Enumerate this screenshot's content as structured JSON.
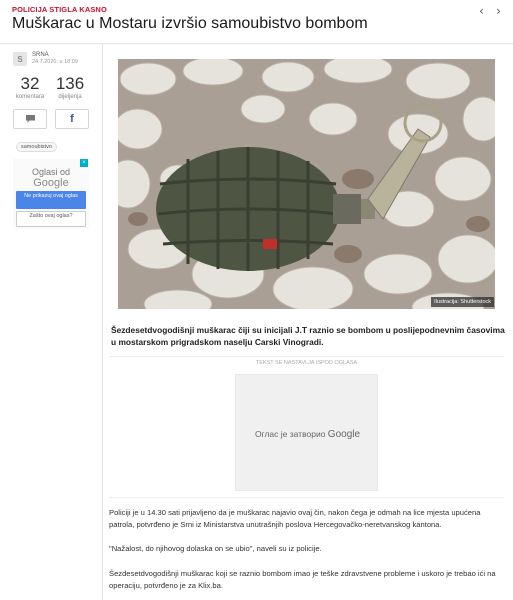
{
  "header": {
    "kicker": "POLICIJA STIGLA KASNO",
    "title": "Muškarac u Mostaru izvršio samoubistvo bombom",
    "prev_icon": "chevron-left-icon",
    "next_icon": "chevron-right-icon"
  },
  "sidebar": {
    "source_logo": "S",
    "source_name": "SRNA",
    "date": "24.7.2020. u 18:09",
    "comments_count": "32",
    "comments_label": "komentara",
    "shares_count": "136",
    "shares_label": "dijeljenja",
    "comment_icon": "comment-icon",
    "facebook_icon": "facebook-icon",
    "tag": "samoubistvo",
    "ad": {
      "line1": "Oglasi od",
      "line2": "Google",
      "stop_button": "Ne prikazuj ovaj oglas",
      "why_button": "Zašto ovaj oglas?"
    }
  },
  "article": {
    "image_credit": "Ilustracija: Shutterstock",
    "lead": "Šezdesetdvogodišnji muškarac čiji su inicijali J.T raznio se bombom u poslijepodnevnim časovima u mostarskom prigradskom naselju Carski Vinogradi.",
    "ad_notice": "TEKST SE NASTAVLJA ISPOD OGLASA",
    "closed_ad_text": "Oглас је затворио",
    "closed_ad_brand": "Google",
    "paragraphs": [
      "Policiji je u 14.30 sati prijavljeno da je muškarac najavio ovaj čin, nakon čega je odmah na lice mjesta upućena patrola, potvrđeno je Srni iz Ministarstva unutrašnjih poslova Hercegovačko-neretvanskog kantona.",
      "\"Nažalost, do njihovog dolaska on se ubio\", naveli su iz policije.",
      "Šezdesetdvogodišnji muškarac koji se raznio bombom imao je teške zdravstvene probleme i uskoro je trebao ići na operaciju, potvrđeno je za Klix.ba."
    ]
  },
  "colors": {
    "accent": "#c8102e",
    "google_button": "#4a86e8",
    "facebook": "#3b5998"
  }
}
